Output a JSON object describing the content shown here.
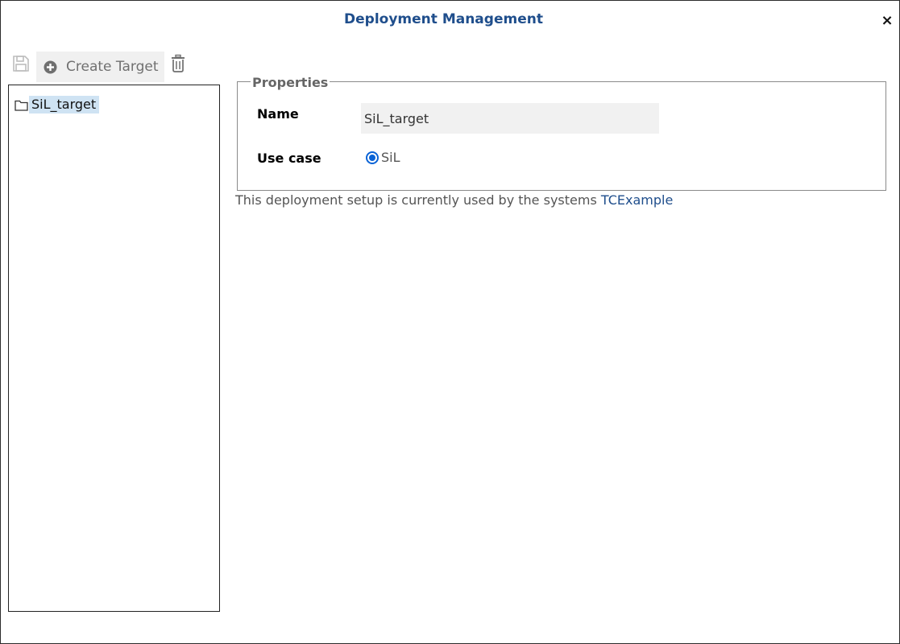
{
  "window": {
    "title": "Deployment Management",
    "close_label": "×"
  },
  "toolbar": {
    "save_icon": "save-icon",
    "create_label": "Create Target",
    "create_icon": "plus-circle-icon",
    "delete_icon": "trash-icon"
  },
  "tree": {
    "items": [
      {
        "label": "SiL_target",
        "icon": "folder-icon",
        "selected": true
      }
    ]
  },
  "properties": {
    "legend": "Properties",
    "name_label": "Name",
    "name_value": "SiL_target",
    "use_case_label": "Use case",
    "use_case_options": [
      {
        "label": "SiL",
        "checked": true
      }
    ]
  },
  "usage": {
    "text": "This deployment setup is currently used by the systems ",
    "link": "TCExample"
  },
  "colors": {
    "title": "#1f4e8c",
    "selection": "#cfe3f3",
    "radio": "#0a63d6",
    "link": "#1f4e8c"
  }
}
